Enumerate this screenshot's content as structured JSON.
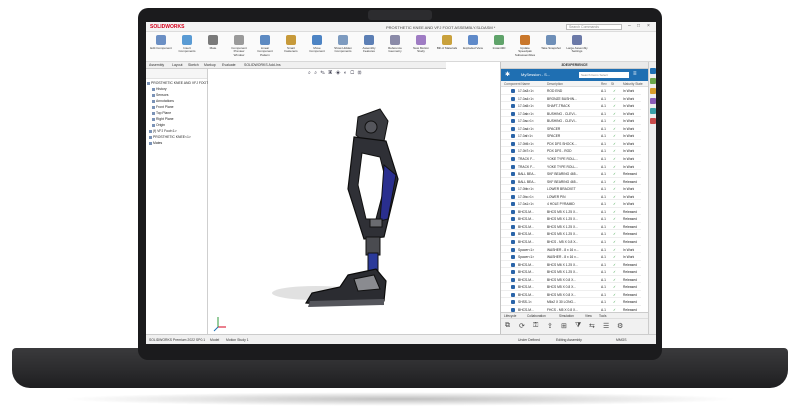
{
  "window": {
    "logo": "SOLIDWORKS",
    "file_title": "PROSTHETIC KNEE AND VFJ FOOT ASSEMBLY.SLDASM *",
    "search_placeholder": "Search Commands"
  },
  "ribbon": {
    "buttons": [
      "Edit Component",
      "Insert Components",
      "Mate",
      "Component Preview Window",
      "Linear Component Pattern",
      "Smart Fasteners",
      "Move Component",
      "Show Hidden Components",
      "Assembly Features",
      "Reference Geometry",
      "New Motion Study",
      "Bill of Materials",
      "Exploded View",
      "Instant3D",
      "Update Speedpak Subassemblies",
      "Take Snapshot",
      "Large Assembly Settings"
    ]
  },
  "command_tabs": [
    "Assembly",
    "Layout",
    "Sketch",
    "Markup",
    "Evaluate",
    "SOLIDWORKS Add-Ins"
  ],
  "feature_tree": {
    "items": [
      "PROSTHETIC KNEE AND VFJ FOOT",
      "History",
      "Sensors",
      "Annotations",
      "Front Plane",
      "Top Plane",
      "Right Plane",
      "Origin",
      "(f) VFJ Foot<1>",
      "PROSTHETIC KNEE<1>",
      "Mates"
    ]
  },
  "pdm": {
    "header": "3DEXPERIENCE",
    "session": "MySession - S...",
    "search_placeholder": "Search Items Select",
    "columns": [
      "Component Name",
      "Description",
      "Rev",
      "St",
      "Maturity State"
    ],
    "rows": [
      {
        "name": "17-0a3>1<",
        "desc": "ROD END",
        "rev": "A.1",
        "state": "In Work"
      },
      {
        "name": "17-0a4>1<",
        "desc": "BRONZE BUSHIN...",
        "rev": "A.1",
        "state": "In Work"
      },
      {
        "name": "17-0a5>1<",
        "desc": "SHAFT-TRACK",
        "rev": "A.1",
        "state": "In Work"
      },
      {
        "name": "17-0ab>1<",
        "desc": "BUSHING - CLEVI...",
        "rev": "A.1",
        "state": "In Work"
      },
      {
        "name": "17-0ac>1<",
        "desc": "BUSHING - CLEVI...",
        "rev": "A.1",
        "state": "In Work"
      },
      {
        "name": "17-0ad>1<",
        "desc": "SPACER",
        "rev": "A.1",
        "state": "In Work"
      },
      {
        "name": "17-0af>1<",
        "desc": "SPACER",
        "rev": "A.1",
        "state": "In Work"
      },
      {
        "name": "17-0b5>1<",
        "desc": "PDX DFS SHOCK...",
        "rev": "A.1",
        "state": "In Work"
      },
      {
        "name": "17-0b7>1<",
        "desc": "PDX DFS - ROD",
        "rev": "A.1",
        "state": "In Work"
      },
      {
        "name": "TRACK F...",
        "desc": "YOKE TYPE ROLL...",
        "rev": "A.1",
        "state": "In Work"
      },
      {
        "name": "TRACK F...",
        "desc": "YOKE TYPE ROLL...",
        "rev": "A.1",
        "state": "In Work"
      },
      {
        "name": "BALL BEA...",
        "desc": "SKF BEARING 465...",
        "rev": "A.1",
        "state": "Released"
      },
      {
        "name": "BALL BEA...",
        "desc": "SKF BEARING 465...",
        "rev": "A.1",
        "state": "Released"
      },
      {
        "name": "17-0bb>1<",
        "desc": "LOWER BRACKET",
        "rev": "A.1",
        "state": "In Work"
      },
      {
        "name": "17-0bc>1<",
        "desc": "LOWER PIN",
        "rev": "A.1",
        "state": "In Work"
      },
      {
        "name": "17-0a1>1<",
        "desc": "4 HOLE PYRAMID",
        "rev": "A.1",
        "state": "In Work"
      },
      {
        "name": "BHCS-M...",
        "desc": "BHCS M5 X 1.25 X...",
        "rev": "A.1",
        "state": "Released"
      },
      {
        "name": "BHCS-M...",
        "desc": "BHCS M5 X 1.25 X...",
        "rev": "A.1",
        "state": "Released"
      },
      {
        "name": "BHCS-M...",
        "desc": "BHCS M5 X 1.25 X...",
        "rev": "A.1",
        "state": "Released"
      },
      {
        "name": "BHCS-M...",
        "desc": "BHCS M5 X 1.25 X...",
        "rev": "A.1",
        "state": "Released"
      },
      {
        "name": "BHCS-M...",
        "desc": "BHCS - M5 X 0.8 X...",
        "rev": "A.1",
        "state": "Released"
      },
      {
        "name": "Spacer<1>",
        "desc": "WASHER - 8 x 16 x...",
        "rev": "A.1",
        "state": "In Work"
      },
      {
        "name": "Spacer<1>",
        "desc": "WASHER - 8 x 16 x...",
        "rev": "A.1",
        "state": "In Work"
      },
      {
        "name": "BHCS-M...",
        "desc": "BHCS M6 X 1.25 X...",
        "rev": "A.1",
        "state": "Released"
      },
      {
        "name": "BHCS-M...",
        "desc": "BHCS M5 X 1.25 X...",
        "rev": "A.1",
        "state": "Released"
      },
      {
        "name": "BHCS-M...",
        "desc": "BHCS M5 X 0.8 X...",
        "rev": "A.1",
        "state": "Released"
      },
      {
        "name": "BHCS-M...",
        "desc": "BHCS M5 X 0.8 X...",
        "rev": "A.1",
        "state": "Released"
      },
      {
        "name": "BHCS-M...",
        "desc": "BHCS M5 X 0.8 X...",
        "rev": "A.1",
        "state": "Released"
      },
      {
        "name": "SHSS-1<",
        "desc": "M6x2 X 30 LONG...",
        "rev": "A.1",
        "state": "Released"
      },
      {
        "name": "BHCS-M...",
        "desc": "FHCS - M5 X 0.8 X...",
        "rev": "A.1",
        "state": "Released"
      },
      {
        "name": "BHCS-M...",
        "desc": "BHCS M5 X 1.25 X...",
        "rev": "A.1",
        "state": "Released"
      }
    ],
    "bottom_tabs": [
      "Lifecycle",
      "Collaboration",
      "Simulation",
      "View",
      "Tools"
    ]
  },
  "status_bar": {
    "left": "SOLIDWORKS Premium 2022 SP0.1",
    "tabs": [
      "Model",
      "Motion Study 1"
    ],
    "under_defined": "Under Defined",
    "editing": "Editing Assembly",
    "units": "MMGS"
  },
  "colors": {
    "accent": "#1f6fb2",
    "brand": "#d6001c",
    "prosthetic_body": "#2f3036",
    "prosthetic_accent": "#2a2f8f"
  }
}
